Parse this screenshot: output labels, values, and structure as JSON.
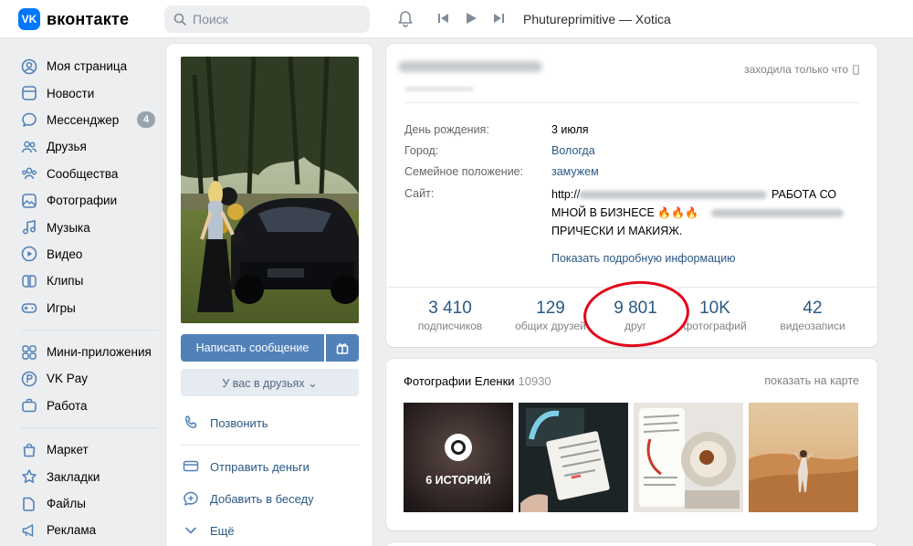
{
  "header": {
    "logo_mark": "VK",
    "logo_text": "вконтакте",
    "search_placeholder": "Поиск",
    "now_playing": "Phutureprimitive — Xotica"
  },
  "icons": {
    "search": "search-icon",
    "notifications": "bell-icon",
    "prev": "previous-track-icon",
    "play": "play-icon",
    "next": "next-track-icon"
  },
  "colors": {
    "accent": "#0077ff",
    "link": "#2a5885",
    "button": "#5181b8",
    "highlight_circle": "#e2061a"
  },
  "leftnav": {
    "items": [
      {
        "label": "Моя страница",
        "icon": "user-icon"
      },
      {
        "label": "Новости",
        "icon": "newspaper-icon"
      },
      {
        "label": "Мессенджер",
        "icon": "chat-bubble-icon",
        "badge": "4"
      },
      {
        "label": "Друзья",
        "icon": "friends-icon"
      },
      {
        "label": "Сообщества",
        "icon": "communities-icon"
      },
      {
        "label": "Фотографии",
        "icon": "photo-icon"
      },
      {
        "label": "Музыка",
        "icon": "music-note-icon"
      },
      {
        "label": "Видео",
        "icon": "video-play-icon"
      },
      {
        "label": "Клипы",
        "icon": "clips-icon"
      },
      {
        "label": "Игры",
        "icon": "gamepad-icon"
      }
    ],
    "items2": [
      {
        "label": "Мини-приложения",
        "icon": "mini-apps-icon"
      },
      {
        "label": "VK Pay",
        "icon": "vk-pay-icon"
      },
      {
        "label": "Работа",
        "icon": "briefcase-icon"
      }
    ],
    "items3": [
      {
        "label": "Маркет",
        "icon": "shopping-bag-icon"
      },
      {
        "label": "Закладки",
        "icon": "star-icon"
      },
      {
        "label": "Файлы",
        "icon": "file-icon"
      },
      {
        "label": "Реклама",
        "icon": "megaphone-icon"
      }
    ]
  },
  "profile_side": {
    "write_message": "Написать сообщение",
    "in_friends": "У вас в друзьях ⌄",
    "actions": [
      {
        "label": "Позвонить",
        "icon": "phone-icon"
      },
      {
        "label": "Отправить деньги",
        "icon": "money-transfer-icon"
      },
      {
        "label": "Добавить в беседу",
        "icon": "add-to-chat-icon"
      },
      {
        "label": "Ещё",
        "icon": "chevron-down-icon"
      }
    ]
  },
  "profile": {
    "online_status": "заходила только что",
    "info": [
      {
        "label": "День рождения:",
        "value": "3 июля"
      },
      {
        "label": "Город:",
        "value": "Вологда"
      },
      {
        "label": "Семейное положение:",
        "value": "замужем"
      }
    ],
    "site_label": "Сайт:",
    "site_lines": [
      "http://",
      "РАБОТА СО",
      "МНОЙ В БИЗНЕСЕ",
      "🔥🔥🔥",
      "ПРИЧЕСКИ И МАКИЯЖ."
    ],
    "show_more": "Показать подробную информацию",
    "counters": [
      {
        "num": "3 410",
        "label": "подписчиков"
      },
      {
        "num": "129",
        "label": "общих друзей"
      },
      {
        "num": "9 801",
        "label": "друг"
      },
      {
        "num": "10K",
        "label": "фотографий"
      },
      {
        "num": "42",
        "label": "видеозаписи"
      }
    ]
  },
  "photos": {
    "title": "Фотографии Еленки",
    "count": "10930",
    "map_link": "показать на карте",
    "stories_label": "6 ИСТОРИЙ"
  }
}
